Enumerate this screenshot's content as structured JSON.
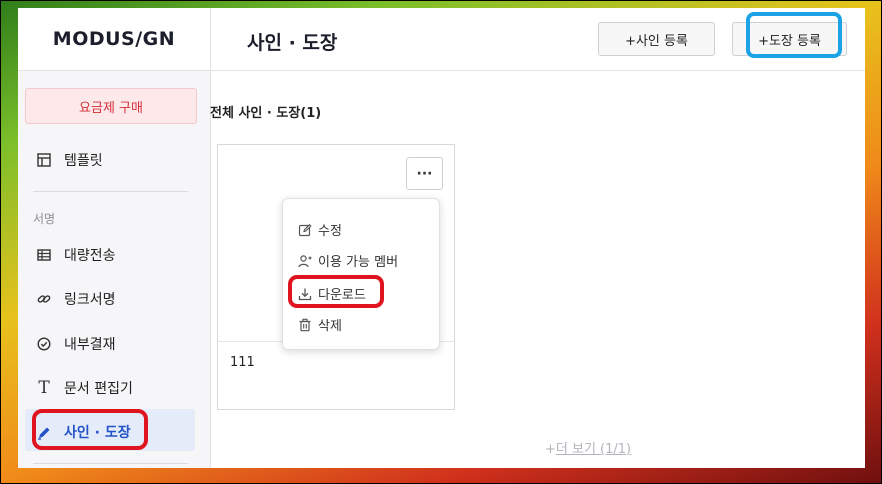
{
  "app": {
    "logo": "MODUS/GN"
  },
  "sidebar": {
    "plan_button": "요금제 구매",
    "template_label": "템플릿",
    "section_label": "서명",
    "items": [
      {
        "label": "대량전송",
        "icon": "table-icon"
      },
      {
        "label": "링크서명",
        "icon": "link-icon"
      },
      {
        "label": "내부결재",
        "icon": "check-circle-icon"
      },
      {
        "label": "문서 편집기",
        "icon": "text-icon"
      },
      {
        "label": "사인 · 도장",
        "icon": "pen-icon",
        "active": true
      }
    ]
  },
  "header": {
    "title": "사인 · 도장",
    "add_sign_button": "+사인 등록",
    "add_stamp_button": "+도장 등록"
  },
  "main": {
    "count_title": "전체 사인 · 도장(1)",
    "card": {
      "name": "111",
      "more_button": "···"
    },
    "menu": [
      {
        "label": "수정",
        "icon": "edit-icon"
      },
      {
        "label": "이용 가능 멤버",
        "icon": "user-plus-icon"
      },
      {
        "label": "다운로드",
        "icon": "download-icon"
      },
      {
        "label": "삭제",
        "icon": "trash-icon"
      }
    ],
    "more_view_plus": "+",
    "more_view": "더 보기 (1/1)"
  },
  "colors": {
    "accent_blue": "#2453c9",
    "plan_red": "#d4313b",
    "highlight_red": "#e0141e",
    "highlight_blue": "#1ca3e6"
  }
}
